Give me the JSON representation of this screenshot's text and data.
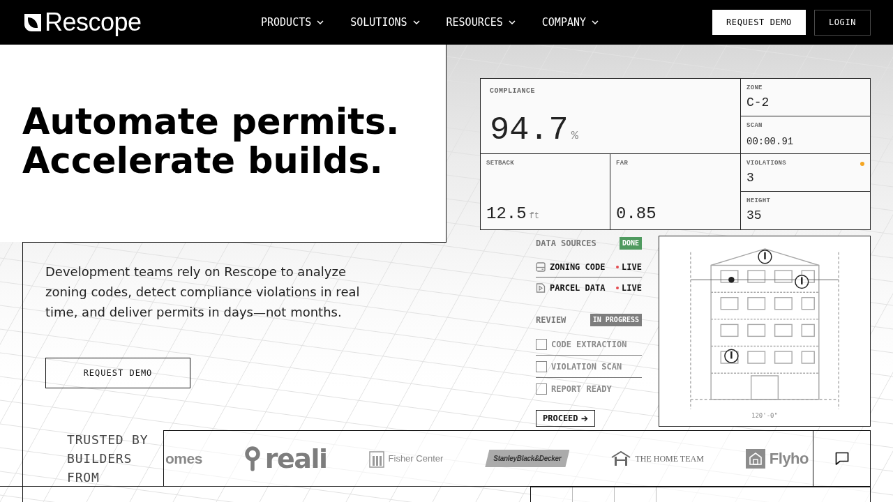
{
  "navbar": {
    "brand": "Rescope",
    "menu": [
      {
        "label": "PRODUCTS"
      },
      {
        "label": "SOLUTIONS"
      },
      {
        "label": "RESOURCES"
      },
      {
        "label": "COMPANY"
      }
    ],
    "actions": [
      {
        "label": "REQUEST DEMO",
        "kind": "solid"
      },
      {
        "label": "LOGIN",
        "kind": "outline"
      }
    ]
  },
  "hero": {
    "headline": [
      "Automate permits.",
      "Accelerate builds."
    ],
    "description": "Development teams rely on Rescope to analyze zoning codes, detect compliance violations in real time, and deliver permits in days—not months.",
    "cta": "REQUEST DEMO"
  },
  "metrics": {
    "compliance": {
      "label": "COMPLIANCE",
      "value": "94.7",
      "unit": "%"
    },
    "zone": {
      "label": "ZONE",
      "value": "C-2"
    },
    "scan": {
      "label": "SCAN",
      "value": "00:00.91"
    },
    "setback": {
      "label": "SETBACK",
      "value": "12.5",
      "unit": "ft"
    },
    "far": {
      "label": "FAR",
      "value": "0.85"
    },
    "violations": {
      "label": "VIOLATIONS",
      "value": "3",
      "alert": true
    },
    "height": {
      "label": "HEIGHT",
      "value": "35"
    }
  },
  "data_sources": {
    "title": "DATA SOURCES",
    "status": {
      "label": "DONE",
      "kind": "done"
    },
    "items": [
      {
        "name": "ZONING CODE",
        "status": "LIVE",
        "kind": "drive"
      },
      {
        "name": "PARCEL DATA",
        "status": "LIVE",
        "kind": "file"
      }
    ]
  },
  "review": {
    "title": "REVIEW",
    "status": {
      "label": "IN PROGRESS",
      "kind": "in_progress"
    },
    "items": [
      {
        "label": "CODE EXTRACTION",
        "checked": false
      },
      {
        "label": "VIOLATION SCAN",
        "checked": false
      },
      {
        "label": "REPORT READY",
        "checked": false
      }
    ],
    "action": "PROCEED"
  },
  "plan_drawing": {
    "dimension": "120'-0\""
  },
  "trusted": {
    "label": "TRUSTED BY BUILDERS FROM",
    "logos": [
      {
        "text": "omes",
        "kind": "wordmark"
      },
      {
        "text": "reali",
        "kind": "pin"
      },
      {
        "text": "Fisher Center",
        "kind": "columns"
      },
      {
        "text": "StanleyBlack&Decker",
        "kind": "banner"
      },
      {
        "text": "THE HOME TEAM",
        "kind": "house"
      },
      {
        "text": "Flyho",
        "kind": "tile"
      }
    ]
  }
}
